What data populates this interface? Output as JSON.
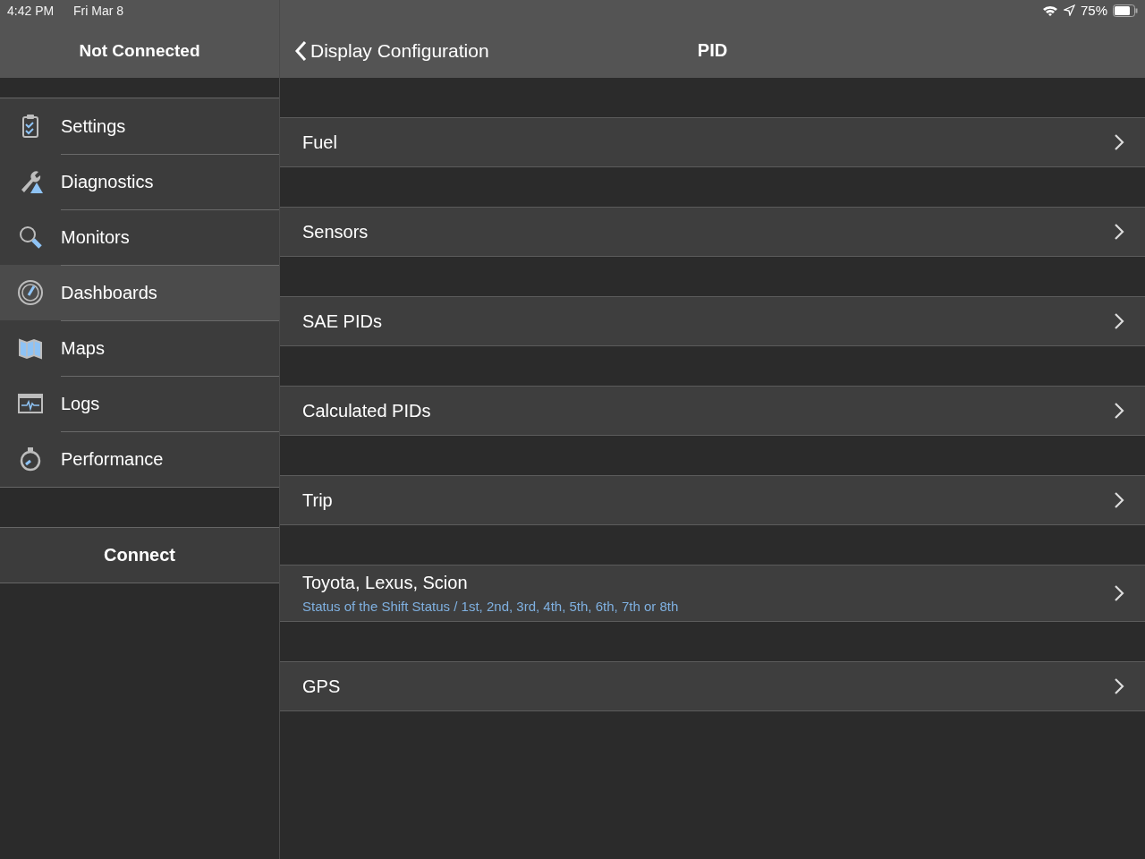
{
  "status_bar": {
    "time": "4:42 PM",
    "date": "Fri Mar 8",
    "battery": "75%"
  },
  "sidebar": {
    "title": "Not Connected",
    "items": [
      {
        "label": "Settings",
        "selected": false
      },
      {
        "label": "Diagnostics",
        "selected": false
      },
      {
        "label": "Monitors",
        "selected": false
      },
      {
        "label": "Dashboards",
        "selected": true
      },
      {
        "label": "Maps",
        "selected": false
      },
      {
        "label": "Logs",
        "selected": false
      },
      {
        "label": "Performance",
        "selected": false
      }
    ],
    "connect_button": "Connect"
  },
  "nav": {
    "back": "Display Configuration",
    "title": "PID"
  },
  "rows": [
    {
      "label": "Fuel"
    },
    {
      "label": "Sensors"
    },
    {
      "label": "SAE PIDs"
    },
    {
      "label": "Calculated PIDs"
    },
    {
      "label": "Trip"
    },
    {
      "label": "Toyota, Lexus, Scion",
      "subtitle": "Status of the Shift Status / 1st, 2nd, 3rd, 4th, 5th, 6th, 7th or 8th"
    },
    {
      "label": "GPS"
    }
  ]
}
